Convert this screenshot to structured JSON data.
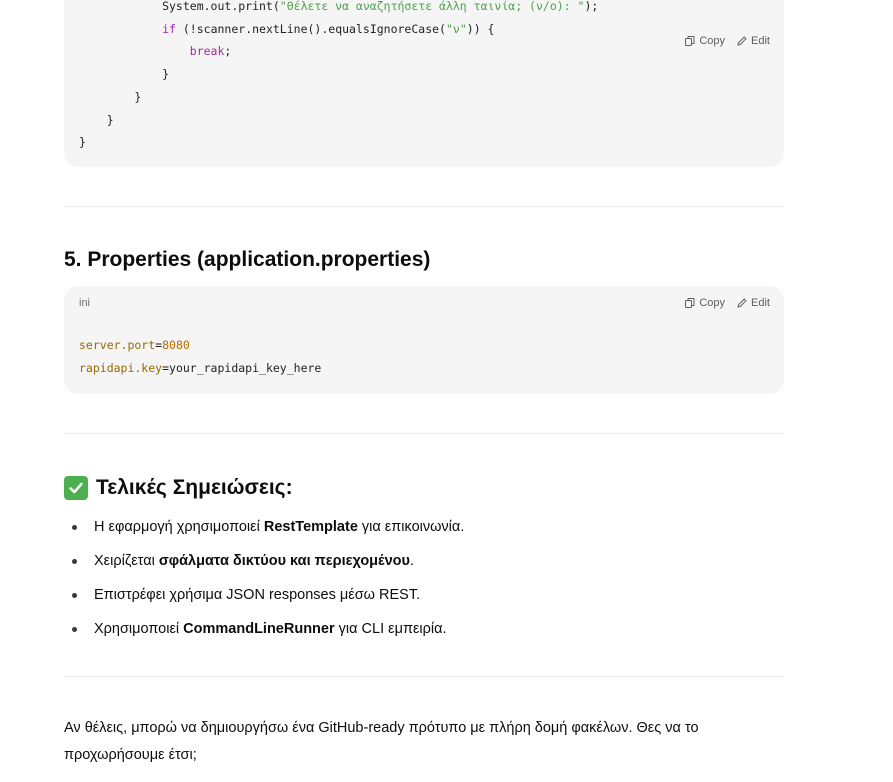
{
  "code_block_1": {
    "actions": {
      "copy": "Copy",
      "edit": "Edit"
    },
    "lines": [
      [
        {
          "t": "            System.out.print(",
          "c": "plain"
        },
        {
          "t": "\"Θέλετε να αναζητήσετε άλλη ταινία; (ν/ο): \"",
          "c": "str"
        },
        {
          "t": ");",
          "c": "plain"
        }
      ],
      [
        {
          "t": "            ",
          "c": "plain"
        },
        {
          "t": "if",
          "c": "kw"
        },
        {
          "t": " (!scanner.nextLine().equalsIgnoreCase(",
          "c": "plain"
        },
        {
          "t": "\"ν\"",
          "c": "str"
        },
        {
          "t": ")) {",
          "c": "plain"
        }
      ],
      [
        {
          "t": "                ",
          "c": "plain"
        },
        {
          "t": "break",
          "c": "kw"
        },
        {
          "t": ";",
          "c": "plain"
        }
      ],
      [
        {
          "t": "            }",
          "c": "plain"
        }
      ],
      [
        {
          "t": "        }",
          "c": "plain"
        }
      ],
      [
        {
          "t": "    }",
          "c": "plain"
        }
      ],
      [
        {
          "t": "}",
          "c": "plain"
        }
      ]
    ]
  },
  "section5": {
    "heading": "5. Properties (application.properties)",
    "code": {
      "lang": "ini",
      "actions": {
        "copy": "Copy",
        "edit": "Edit"
      },
      "lines": [
        [
          {
            "t": "server.port",
            "c": "key"
          },
          {
            "t": "=",
            "c": "plain"
          },
          {
            "t": "8080",
            "c": "num"
          }
        ],
        [
          {
            "t": "rapidapi.key",
            "c": "key"
          },
          {
            "t": "=your_rapidapi_key_here",
            "c": "plain"
          }
        ]
      ]
    }
  },
  "notes": {
    "icon": "check-mark-button-emoji",
    "heading": "Τελικές Σημειώσεις:",
    "items": [
      [
        {
          "t": "Η εφαρμογή χρησιμοποιεί ",
          "b": false
        },
        {
          "t": "RestTemplate",
          "b": true
        },
        {
          "t": " για επικοινωνία.",
          "b": false
        }
      ],
      [
        {
          "t": "Χειρίζεται ",
          "b": false
        },
        {
          "t": "σφάλματα δικτύου και περιεχομένου",
          "b": true
        },
        {
          "t": ".",
          "b": false
        }
      ],
      [
        {
          "t": "Επιστρέφει χρήσιμα JSON responses μέσω REST.",
          "b": false
        }
      ],
      [
        {
          "t": "Χρησιμοποιεί ",
          "b": false
        },
        {
          "t": "CommandLineRunner",
          "b": true
        },
        {
          "t": " για CLI εμπειρία.",
          "b": false
        }
      ]
    ]
  },
  "closing": "Αν θέλεις, μπορώ να δημιουργήσω ένα GitHub-ready πρότυπο με πλήρη δομή φακέλων. Θες να το προχωρήσουμε έτσι;",
  "colors": {
    "accent_check": "#4caf50",
    "code_bg": "#f5f5f5"
  }
}
